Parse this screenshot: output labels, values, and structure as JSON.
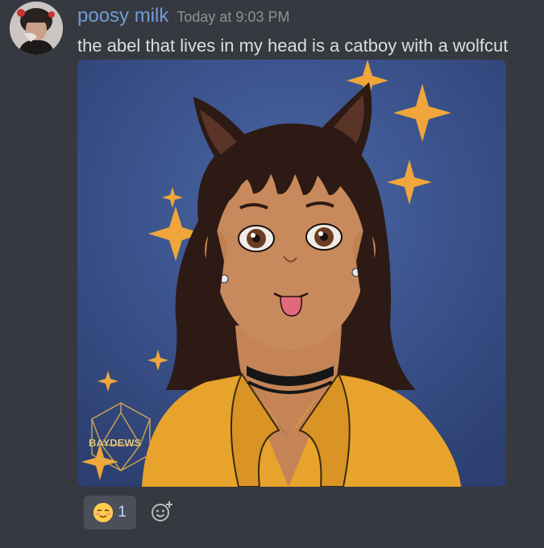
{
  "message": {
    "author": "poosy milk",
    "timestamp": "Today at 9:03 PM",
    "text": "the abel that lives in my head is a catboy with a wolfcut",
    "author_color": "#6f9bd8"
  },
  "attachment": {
    "watermark": "BAYDEWS",
    "background_color": "#32487e"
  },
  "reactions": [
    {
      "emoji": "blushing-smile-emoji",
      "count": "1"
    }
  ],
  "icons": {
    "avatar": "user-avatar",
    "add_reaction": "add-reaction-icon"
  }
}
